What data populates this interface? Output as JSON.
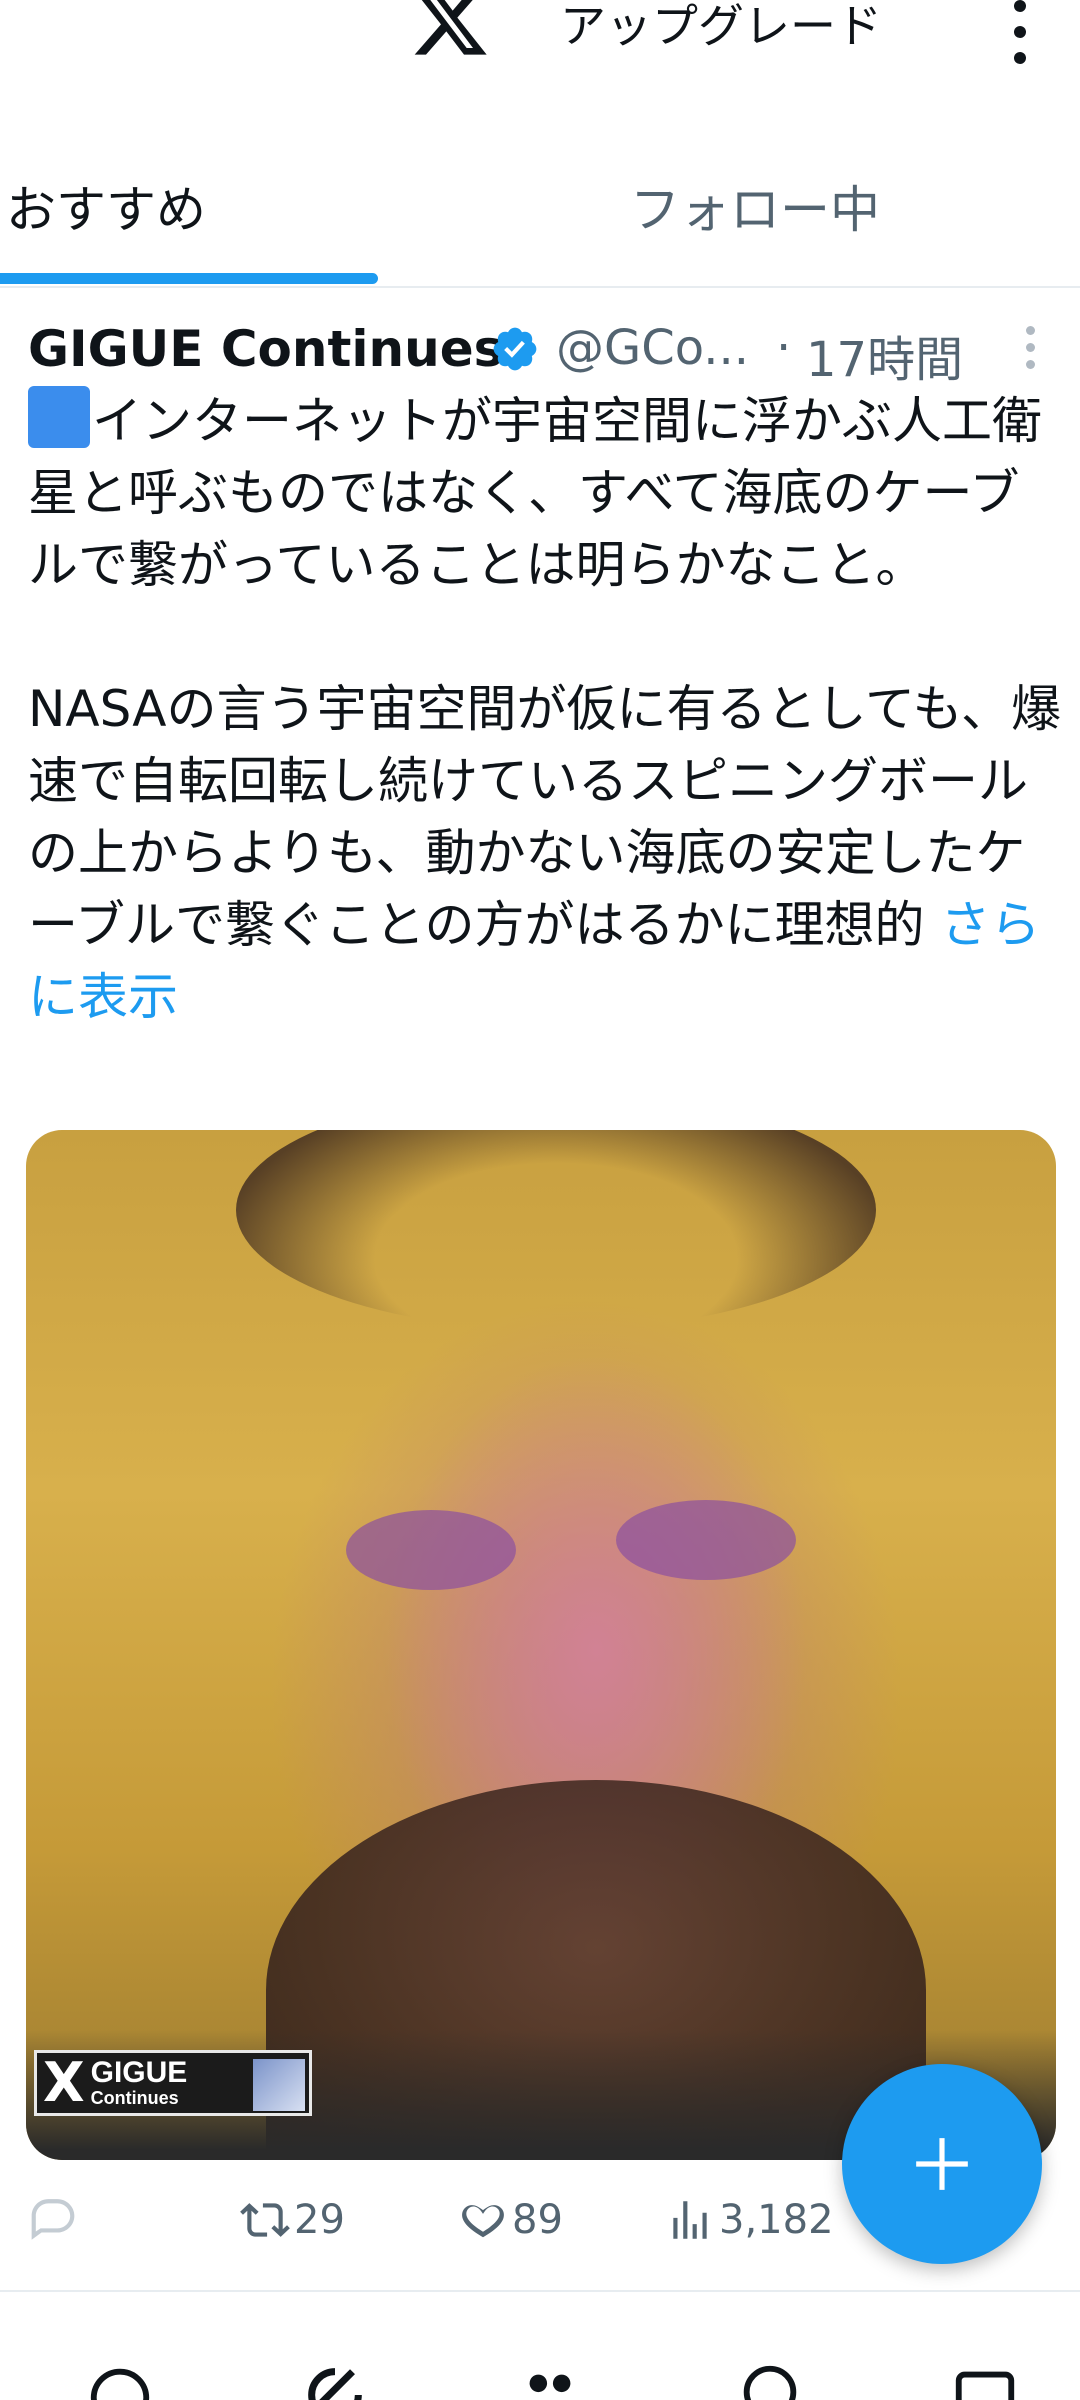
{
  "topbar": {
    "logo_icon": "x-logo-icon",
    "upgrade_label": "アップグレード",
    "more_icon": "more-vertical-icon"
  },
  "tabs": [
    {
      "label": "おすすめ",
      "active": true
    },
    {
      "label": "フォロー中",
      "active": false
    }
  ],
  "tweet": {
    "author_name": "GIGUE Continues",
    "verified": true,
    "handle": "@GCo...",
    "separator": "·",
    "time": "17時間",
    "text_para1": "インターネットが宇宙空間に浮かぶ人工衛星と呼ぶものではなく、すべて海底のケーブルで繋がっていることは明らかなこと。",
    "text_para2": "NASAの言う宇宙空間が仮に有るとしても、爆速で自転回転し続けているスピニングボールの上からよりも、動かない海底の安定したケーブルで繋ぐことの方がはるかに理想的",
    "show_more_label": "さらに表示",
    "media": {
      "logo_x": "X",
      "logo_line1": "GIGUE",
      "logo_line2": "Continues"
    },
    "actions": {
      "reply_count": "",
      "retweet_count": "29",
      "like_count": "89",
      "views_count": "3,182"
    }
  },
  "colors": {
    "accent": "#1d9bf0",
    "text_primary": "#0f1419",
    "text_secondary": "#536471"
  }
}
